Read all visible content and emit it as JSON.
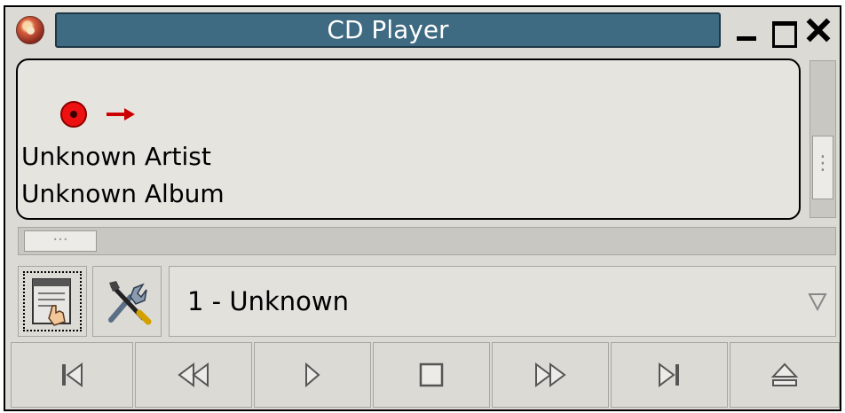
{
  "window": {
    "title": "CD Player",
    "controls": {
      "minimize": "minimize-icon",
      "maximize": "maximize-icon",
      "close": "close-icon"
    }
  },
  "display": {
    "artist": "Unknown Artist",
    "album": "Unknown Album",
    "icons": [
      "cd-track-icon",
      "arrow-right-icon"
    ]
  },
  "toolbar": {
    "track_selector": {
      "value": "1 - Unknown"
    },
    "buttons": [
      "track-editor-icon",
      "preferences-tools-icon"
    ]
  },
  "transport": {
    "buttons": [
      "previous-track",
      "rewind",
      "play",
      "stop",
      "fast-forward",
      "next-track",
      "eject"
    ]
  },
  "colors": {
    "title_bar": "#3e6a82",
    "window_bg": "#dcdad5",
    "track_icon": "#ee1111"
  }
}
